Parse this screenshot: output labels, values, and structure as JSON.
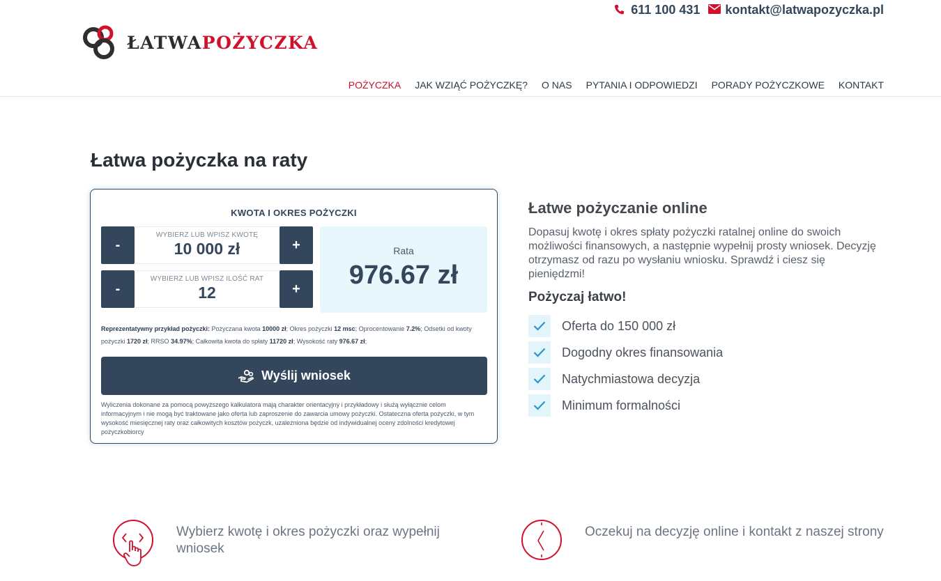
{
  "header": {
    "phone": "611 100 431",
    "email": "kontakt@latwapozyczka.pl",
    "logo_part1": "ŁATWA",
    "logo_part2": "POŻYCZKA",
    "nav": [
      {
        "label": "POŻYCZKA"
      },
      {
        "label": "JAK WZIĄĆ POŻYCZKĘ?"
      },
      {
        "label": "O NAS"
      },
      {
        "label": "PYTANIA I ODPOWIEDZI"
      },
      {
        "label": "PORADY POŻYCZKOWE"
      },
      {
        "label": "KONTAKT"
      }
    ]
  },
  "page": {
    "title": "Łatwa pożyczka na raty"
  },
  "calculator": {
    "title": "KWOTA I OKRES POŻYCZKI",
    "minus": "-",
    "plus": "+",
    "amount_caption": "WYBIERZ LUB WPISZ KWOTĘ",
    "amount_value": "10 000 zł",
    "installments_caption": "WYBIERZ LUB WPISZ ILOŚĆ RAT",
    "installments_value": "12",
    "rate_label": "Rata",
    "rate_value": "976.67 zł",
    "repr": {
      "lead": "Reprezentatywny przykład pożyczki:",
      "t1": " Pożyczana kwota ",
      "v1": "10000 zł",
      "t2": "; Okres pożyczki ",
      "v2": "12 msc",
      "t3": "; Oprocentowanie ",
      "v3": "7.2%",
      "t4": "; Odsetki od kwoty pożyczki ",
      "v4": "1720 zł",
      "t5": "; RRSO ",
      "v5": "34.97%",
      "t6": "; Całkowita kwota do spłaty ",
      "v6": "11720 zł",
      "t7": "; Wysokość raty ",
      "v7": "976.67 zł",
      "t8": ";"
    },
    "send_label": "Wyślij wniosek",
    "disclaimer": "Wyliczenia dokonane za pomocą powyższego kalkulatora mają charakter orientacyjny i przykładowy i służą wyłącznie celom informacyjnym i nie mogą być traktowane jako oferta lub zaproszenie do zawarcia umowy pożyczki. Ostateczna oferta pożyczki, w tym wysokość miesięcznej raty oraz całkowitych kosztów pożyczk, uzależniona będzie od indywidualnej oceny zdolności kredytowej pożyczkobiorcy"
  },
  "info": {
    "heading": "Łatwe pożyczanie online",
    "description": "Dopasuj kwotę i okres spłaty pożyczki ratalnej online do swoich możliwości finansowych, a następnie wypełnij prosty wniosek. Decyzję otrzymasz od razu po wysłaniu wniosku. Sprawdź i ciesz się pieniędzmi!",
    "subheading": "Pożyczaj łatwo!",
    "features": [
      {
        "label": "Oferta do 150 000 zł"
      },
      {
        "label": "Dogodny okres finansowania"
      },
      {
        "label": "Natychmiastowa decyzja"
      },
      {
        "label": "Minimum formalności"
      }
    ]
  },
  "steps": [
    {
      "text": "Wybierz kwotę i okres pożyczki oraz wypełnij wniosek"
    },
    {
      "text": "Oczekuj na decyzję online i kontakt z naszej strony"
    }
  ],
  "colors": {
    "primary": "#34465c",
    "accent": "#d0112b",
    "light": "#e8f7fb"
  }
}
